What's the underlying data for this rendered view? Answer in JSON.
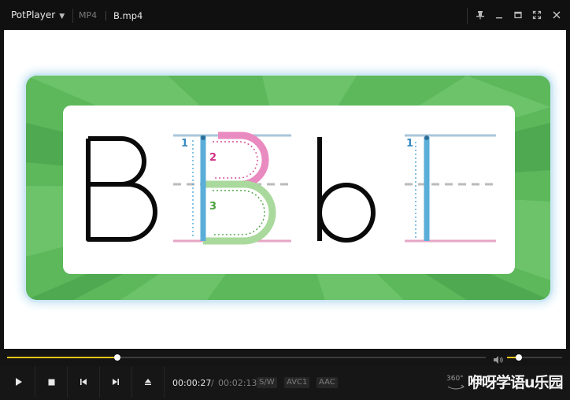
{
  "titlebar": {
    "app_name": "PotPlayer",
    "format": "MP4",
    "file_name": "B.mp4",
    "buttons": [
      "pin-icon",
      "minimize-icon",
      "maximize-icon",
      "fullscreen-icon",
      "close-icon"
    ]
  },
  "video": {
    "letters": {
      "upper": "B",
      "lower": "b"
    },
    "stroke_numbers": [
      "1",
      "2",
      "3",
      "1"
    ],
    "colors": {
      "frame_green": "#5cb85a",
      "trace_blue": "#5aaed8",
      "trace_pink": "#e98ac0",
      "trace_green": "#a9d99c",
      "guide_pink": "#e7a6c4",
      "guide_blue": "#a9c6da"
    }
  },
  "playback": {
    "progress_fraction": 0.23,
    "volume_fraction": 0.22,
    "current_time": "00:00:27",
    "separator": "/",
    "total_time": "00:02:13",
    "tags": [
      "S/W",
      "AVC1",
      "AAC"
    ],
    "vr_label": "360°",
    "brand_text": "咿呀学语u乐园"
  },
  "controls": [
    "play-icon",
    "stop-icon",
    "prev-icon",
    "next-icon",
    "eject-icon"
  ],
  "accent": "#f5c518"
}
